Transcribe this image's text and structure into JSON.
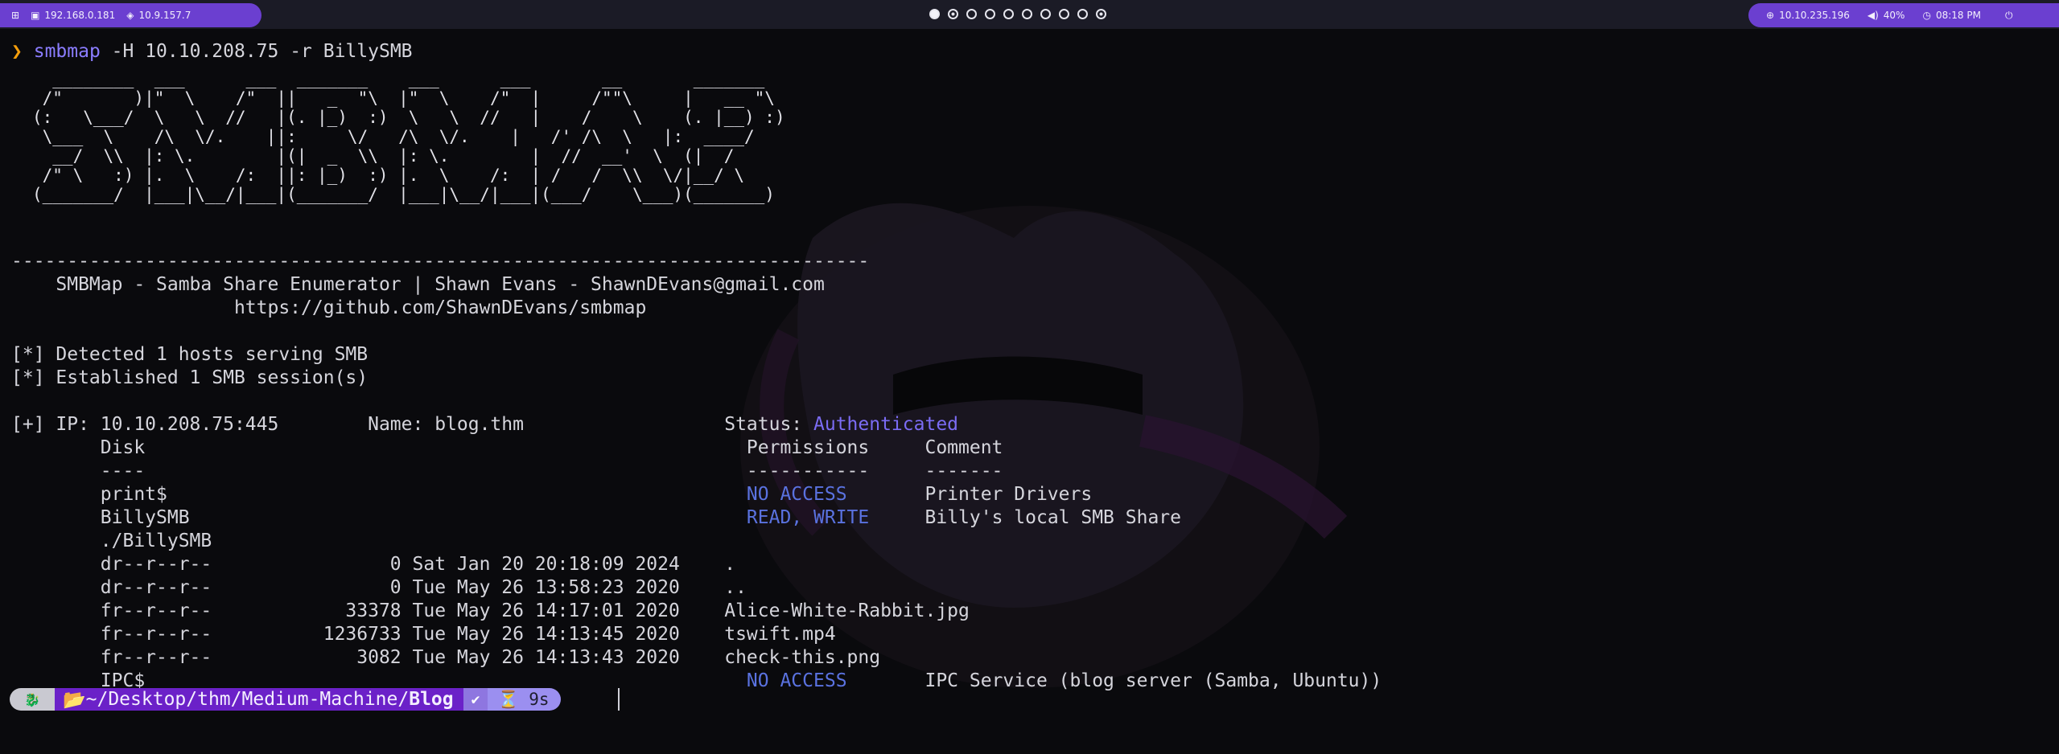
{
  "topbar": {
    "menu_icon": "grid-icon",
    "ip_local": "192.168.0.181",
    "ip_vpn": "10.9.157.7",
    "target_ip": "10.10.235.196",
    "volume": "40%",
    "time": "08:18 PM",
    "workspaces": [
      "active",
      "ring",
      "empty",
      "empty",
      "empty",
      "empty",
      "empty",
      "empty",
      "empty",
      "ring"
    ]
  },
  "terminal": {
    "prompt_symbol": "❯",
    "command_name": "smbmap",
    "command_args": " -H 10.10.208.75 -r BillySMB",
    "banner_art": "  ________  ___      ___  _______    ___      ___       __       _______\n /\"       )|\"  \\    /\"  ||   _  \"\\  |\"  \\    /\"  |     /\"\"\\     |   __ \"\\\n(:   \\___/  \\   \\  //   |(. |_)  :)  \\   \\  //   |    /    \\    (. |__) :)\n \\___  \\    /\\  \\/.    ||:     \\/   /\\  \\/.    |   /' /\\  \\   |:  ____/\n  __/  \\\\  |: \\.        |(|  _  \\\\  |: \\.        |  //  __'  \\  (|  /\n /\" \\   :) |.  \\    /:  ||: |_)  :) |.  \\    /:  | /   /  \\\\  \\/|__/ \\\n(_______/  |___|\\__/|___|(_______/  |___|\\__/|___|(___/    \\___)(_______)",
    "divider": "-----------------------------------------------------------------------------",
    "credit": "    SMBMap - Samba Share Enumerator | Shawn Evans - ShawnDEvans@gmail.com",
    "url": "                    https://github.com/ShawnDEvans/smbmap",
    "detected": "[*] Detected 1 hosts serving SMB",
    "established": "[*] Established 1 SMB session(s)",
    "host_line": "[+] IP: 10.10.208.75:445        Name: blog.thm                  Status: ",
    "status_value": "Authenticated",
    "header_line": "        Disk                                                      Permissions     Comment",
    "header_rule": "        ----                                                      -----------     -------",
    "shares": [
      {
        "name": "        print$                                                    ",
        "perm": "NO ACCESS",
        "gap": "       ",
        "comment": "Printer Drivers"
      },
      {
        "name": "        BillySMB                                                  ",
        "perm": "READ, WRITE",
        "gap": "     ",
        "comment": "Billy's local SMB Share"
      }
    ],
    "dir_label": "        ./BillySMB",
    "files": [
      "        dr--r--r--                0 Sat Jan 20 20:18:09 2024    .",
      "        dr--r--r--                0 Tue May 26 13:58:23 2020    ..",
      "        fr--r--r--            33378 Tue May 26 14:17:01 2020    Alice-White-Rabbit.jpg",
      "        fr--r--r--          1236733 Tue May 26 14:13:45 2020    tswift.mp4",
      "        fr--r--r--             3082 Tue May 26 14:13:43 2020    check-this.png"
    ],
    "ipc_share": {
      "name": "        IPC$                                                      ",
      "perm": "NO ACCESS",
      "gap": "       ",
      "comment": "IPC Service (blog server (Samba, Ubuntu))"
    }
  },
  "prompt_bar": {
    "os_icon": "kali-dragon-icon",
    "folder_icon": "folder-icon",
    "path_prefix": "~/Desktop/thm/Medium-Machine/",
    "path_current": "Blog",
    "status_icon": "check-icon",
    "status_symbol": "✔",
    "timer_icon": "hourglass-icon",
    "duration": "9s"
  },
  "colors": {
    "accent": "#6b3fd0",
    "prompt_arrow": "#f59e0b",
    "command": "#8b7dff",
    "status_auth": "#7b6cf4",
    "permission": "#5a72e0",
    "path_bg": "#6b21c8"
  }
}
